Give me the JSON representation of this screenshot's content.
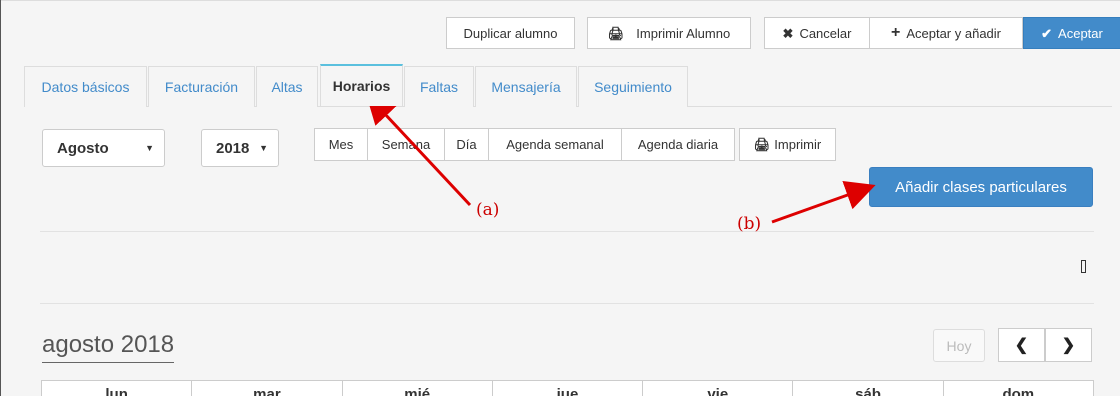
{
  "toolbar": {
    "duplicate_label": "Duplicar alumno",
    "print_label": "Imprimir Alumno",
    "print_icon": "printer-icon",
    "cancel_label": "Cancelar",
    "cancel_icon": "close-icon",
    "accept_add_label": "Aceptar y añadir",
    "accept_add_icon": "plus-icon",
    "accept_label": "Aceptar",
    "accept_icon": "check-icon",
    "accent_color": "#428bca"
  },
  "tabs": [
    {
      "label": "Datos básicos"
    },
    {
      "label": "Facturación"
    },
    {
      "label": "Altas"
    },
    {
      "label": "Horarios",
      "active": true
    },
    {
      "label": "Faltas"
    },
    {
      "label": "Mensajería"
    },
    {
      "label": "Seguimiento"
    }
  ],
  "filters": {
    "month": "Agosto",
    "year": "2018"
  },
  "views": {
    "mes": "Mes",
    "semana": "Semana",
    "dia": "Día",
    "agenda_semanal": "Agenda semanal",
    "agenda_diaria": "Agenda diaria",
    "imprimir": "Imprimir"
  },
  "add_private_classes_label": "Añadir clases particulares",
  "calendar": {
    "title": "agosto 2018",
    "today_label": "Hoy",
    "prev_icon": "chevron-left-icon",
    "next_icon": "chevron-right-icon",
    "weekdays": [
      "lun",
      "mar",
      "mié",
      "jue",
      "vie",
      "sáb",
      "dom"
    ]
  },
  "annotations": {
    "a": "(a)",
    "b": "(b)",
    "color": "#dd0000"
  }
}
